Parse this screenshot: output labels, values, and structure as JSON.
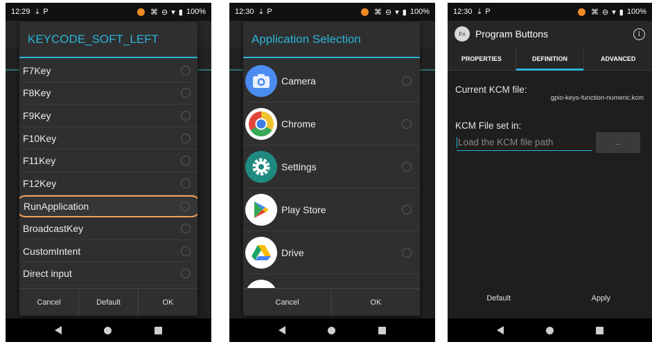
{
  "phone1": {
    "status": {
      "time": "12:29",
      "battery": "100%"
    },
    "dialog": {
      "title": "KEYCODE_SOFT_LEFT",
      "items": [
        {
          "label": "F7Key",
          "selected": false
        },
        {
          "label": "F8Key",
          "selected": false
        },
        {
          "label": "F9Key",
          "selected": false
        },
        {
          "label": "F10Key",
          "selected": false
        },
        {
          "label": "F11Key",
          "selected": false
        },
        {
          "label": "F12Key",
          "selected": false
        },
        {
          "label": "RunApplication",
          "selected": true
        },
        {
          "label": "BroadcastKey",
          "selected": false
        },
        {
          "label": "CustomIntent",
          "selected": false
        },
        {
          "label": "Direct input",
          "selected": false
        }
      ],
      "buttons": {
        "cancel": "Cancel",
        "default": "Default",
        "ok": "OK"
      }
    }
  },
  "phone2": {
    "status": {
      "time": "12:30",
      "battery": "100%"
    },
    "dialog": {
      "title": "Application Selection",
      "apps": [
        {
          "name": "Camera",
          "icon": "camera-icon"
        },
        {
          "name": "Chrome",
          "icon": "chrome-icon"
        },
        {
          "name": "Settings",
          "icon": "settings-icon"
        },
        {
          "name": "Play Store",
          "icon": "play-store-icon"
        },
        {
          "name": "Drive",
          "icon": "drive-icon"
        }
      ],
      "buttons": {
        "cancel": "Cancel",
        "ok": "OK"
      }
    }
  },
  "phone3": {
    "status": {
      "time": "12:30",
      "battery": "100%"
    },
    "toolbar": {
      "icon_text": "Fn",
      "title": "Program Buttons"
    },
    "tabs": [
      {
        "label": "PROPERTIES",
        "active": false
      },
      {
        "label": "DEFINITION",
        "active": true
      },
      {
        "label": "ADVANCED",
        "active": false
      }
    ],
    "current_kcm_label": "Current KCM file:",
    "current_kcm_value": "gpio-keys-function-numeric.kcm",
    "kcm_set_label": "KCM File set in:",
    "kcm_input_placeholder": "Load the KCM file path",
    "browse_label": "...",
    "actions": {
      "default": "Default",
      "apply": "Apply"
    }
  },
  "colors": {
    "accent": "#2ab4d9",
    "highlight": "#f0a35a",
    "background": "#2b2b2b"
  }
}
